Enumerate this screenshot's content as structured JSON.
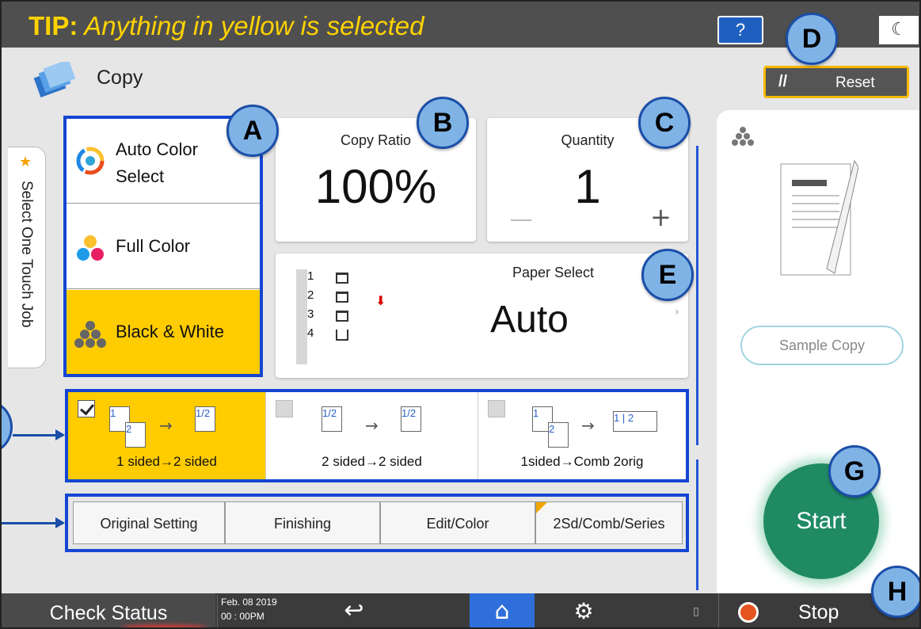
{
  "tip": {
    "prefix": "TIP:",
    "text": " Anything in yellow is selected"
  },
  "topbar": {
    "help_label": "?",
    "night_icon": "moon-icon"
  },
  "header": {
    "title": "Copy",
    "reset_label": "Reset"
  },
  "side_tab": {
    "label": "Select One Touch Job"
  },
  "color_modes": [
    {
      "label_line1": "Auto Color",
      "label_line2": "Select",
      "icon": "auto-color-icon",
      "selected": false
    },
    {
      "label_line1": "Full Color",
      "label_line2": "",
      "icon": "full-color-icon",
      "selected": false
    },
    {
      "label_line1": "Black & White",
      "label_line2": "",
      "icon": "black-white-icon",
      "selected": true
    }
  ],
  "copy_ratio": {
    "label": "Copy Ratio",
    "value": "100%"
  },
  "quantity": {
    "label": "Quantity",
    "value": "1",
    "minus": "−",
    "plus": "+"
  },
  "paper_select": {
    "label": "Paper Select",
    "value": "Auto",
    "trays": [
      "1",
      "2",
      "3",
      "4"
    ]
  },
  "duplex": [
    {
      "label": "1 sided→2 sided",
      "selected": true
    },
    {
      "label": "2 sided→2 sided",
      "selected": false
    },
    {
      "label": "1sided→Comb 2orig",
      "selected": false
    }
  ],
  "tabs": [
    {
      "label": "Original Setting"
    },
    {
      "label": "Finishing"
    },
    {
      "label": "Edit/Color"
    },
    {
      "label": "2Sd/Comb/Series"
    }
  ],
  "right_panel": {
    "sample_copy_label": "Sample Copy",
    "start_label": "Start"
  },
  "bottom_bar": {
    "check_status": "Check Status",
    "date": "Feb. 08 2019",
    "time": "00 : 00PM",
    "stop_label": "Stop"
  },
  "callouts": [
    "A",
    "B",
    "C",
    "D",
    "E",
    "G",
    "H"
  ],
  "colors": {
    "accent_yellow": "#ffcc00",
    "selection_blue": "#1446d2",
    "start_green": "#1f8a64",
    "home_blue": "#2f6fdc",
    "tip_yellow": "#ffd200"
  }
}
